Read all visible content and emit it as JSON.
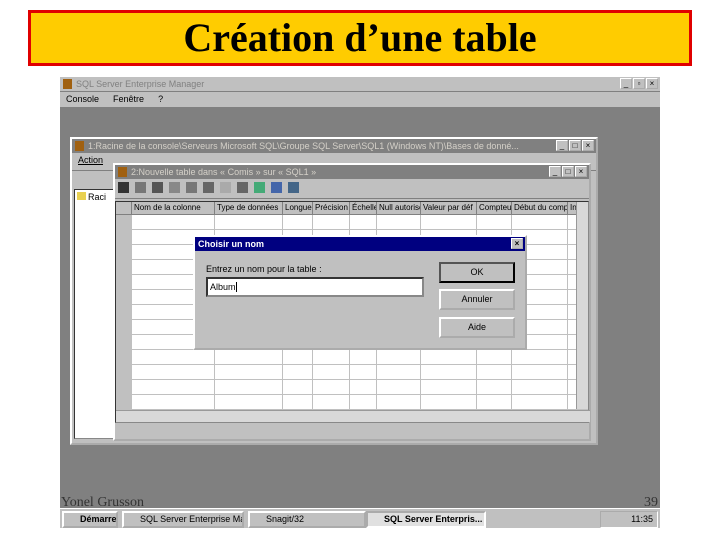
{
  "slide": {
    "title": "Création d’une table",
    "author": "Yonel Grusson",
    "page": "39"
  },
  "app": {
    "title": "SQL Server Enterprise Manager",
    "menu": [
      "Console",
      "Fenêtre",
      "?"
    ]
  },
  "console_window": {
    "title": "1:Racine de la console\\Serveurs Microsoft SQL\\Groupe SQL Server\\SQL1 (Windows NT)\\Bases de donné...",
    "action_label": "Action",
    "tree_item": "Raci"
  },
  "table_window": {
    "title": "2:Nouvelle table dans « Comis » sur « SQL1 »",
    "columns": [
      "Nom de la colonne",
      "Type de données",
      "Longueu",
      "Précision",
      "Échelle",
      "Null autorisé",
      "Valeur par déf",
      "Compteu",
      "Début du comp",
      "Inc"
    ]
  },
  "dialog": {
    "title": "Choisir un nom",
    "prompt": "Entrez un nom pour la table :",
    "value": "Album",
    "ok": "OK",
    "cancel": "Annuler",
    "help": "Aide"
  },
  "taskbar": {
    "start": "Démarrer",
    "items": [
      "SQL Server Enterprise Ma...",
      "Snagit/32",
      "SQL Server Enterpris..."
    ],
    "clock": "11:35"
  }
}
